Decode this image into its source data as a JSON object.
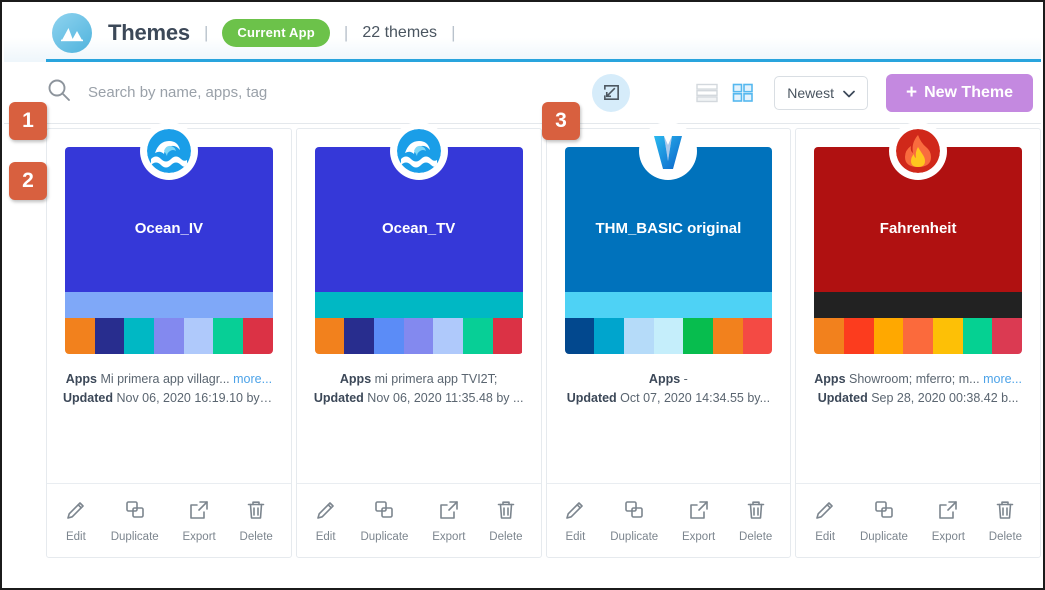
{
  "header": {
    "logo_icon": "themes-logo-icon",
    "title": "Themes",
    "separator": "|",
    "current_app_badge": "Current App",
    "theme_count": "22 themes",
    "accent_color": "#29a4dd"
  },
  "toolbar": {
    "search_icon": "search-icon",
    "search_placeholder": "Search by name, apps, tag",
    "search_value": "",
    "import_icon": "import-icon",
    "list_view_icon": "list-view-icon",
    "grid_view_icon": "grid-view-icon",
    "sort_label": "Newest",
    "sort_chevron": "chevron-down-icon",
    "new_theme_label": "New Theme",
    "new_theme_plus": "+",
    "new_theme_color": "#c489e0"
  },
  "annotations": [
    {
      "number": "1"
    },
    {
      "number": "2"
    },
    {
      "number": "3"
    }
  ],
  "actions_labels": {
    "edit": "Edit",
    "duplicate": "Duplicate",
    "export": "Export",
    "delete": "Delete"
  },
  "meta_labels": {
    "apps": "Apps",
    "updated": "Updated",
    "more": "more..."
  },
  "cards": [
    {
      "name": "Ocean_IV",
      "icon": "wave-icon",
      "main_color": "#3538d8",
      "band_color": "#7fa8f8",
      "swatches": [
        "#f2811d",
        "#282d8e",
        "#00b8c4",
        "#8389ef",
        "#afc9fb",
        "#07cf96",
        "#db3245"
      ],
      "apps": "Mi primera app villagr...",
      "has_more": true,
      "updated": "Nov 06, 2020 16:19.10 by l..."
    },
    {
      "name": "Ocean_TV",
      "icon": "wave-icon",
      "main_color": "#3538d8",
      "band_color": "#00b8c4",
      "swatches": [
        "#f2811d",
        "#282d8e",
        "#5b8cf7",
        "#8389ef",
        "#afc9fb",
        "#07cf96",
        "#db3245"
      ],
      "apps": "mi primera app TVI2T;",
      "has_more": false,
      "updated": "Nov 06, 2020 11:35.48 by ..."
    },
    {
      "name": "THM_BASIC original",
      "icon": "v-logo-icon",
      "main_color": "#0072bc",
      "band_color": "#4ed2f5",
      "swatches": [
        "#02488e",
        "#00a5cd",
        "#b5dbf9",
        "#c5eefb",
        "#07bd4e",
        "#f2811d",
        "#f44a44"
      ],
      "apps": "-",
      "has_more": false,
      "updated": "Oct 07, 2020 14:34.55 by..."
    },
    {
      "name": "Fahrenheit",
      "icon": "flame-icon",
      "main_color": "#b01111",
      "band_color": "#222222",
      "swatches": [
        "#f2811d",
        "#fc3c1e",
        "#ffa800",
        "#fb6a3c",
        "#fdc006",
        "#05d192",
        "#db3a52"
      ],
      "apps": "Showroom; mferro; m...",
      "has_more": true,
      "updated": "Sep 28, 2020 00:38.42 b..."
    }
  ]
}
